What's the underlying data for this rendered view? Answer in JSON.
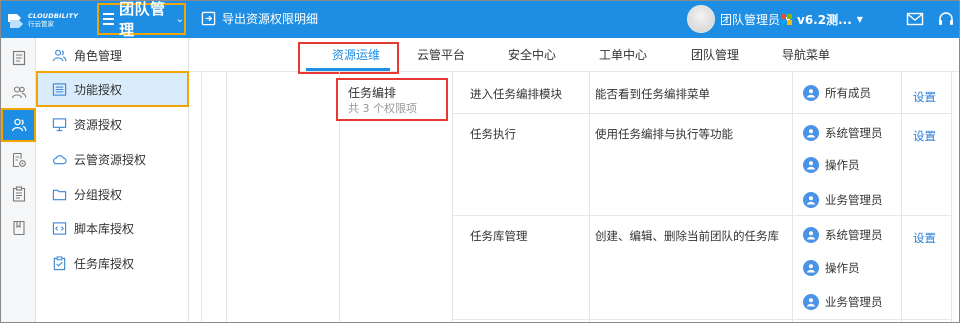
{
  "header": {
    "logo_en": "CLOUDBILITY",
    "logo_cn": "行云管家",
    "team_label": "团队管理",
    "export_label": "导出资源权限明细",
    "user_name": "团队管理员",
    "version": "v6.2测...",
    "colors": {
      "bar": "#1e8ee4",
      "highlight": "#f0a500"
    }
  },
  "rail": [
    "doc-icon",
    "people-icon",
    "user-group-icon",
    "settings-doc-icon",
    "clipboard-icon",
    "book-icon"
  ],
  "sidebar": {
    "items": [
      {
        "label": "角色管理",
        "icon": "role-icon"
      },
      {
        "label": "功能授权",
        "icon": "list-icon"
      },
      {
        "label": "资源授权",
        "icon": "monitor-icon"
      },
      {
        "label": "云管资源授权",
        "icon": "cloud-icon"
      },
      {
        "label": "分组授权",
        "icon": "folder-icon"
      },
      {
        "label": "脚本库授权",
        "icon": "script-icon"
      },
      {
        "label": "任务库授权",
        "icon": "task-icon"
      }
    ]
  },
  "tabs": [
    "资源运维",
    "云管平台",
    "安全中心",
    "工单中心",
    "团队管理",
    "导航菜单"
  ],
  "permissions": {
    "category": {
      "name": "任务编排",
      "count": "共 3 个权限项"
    },
    "rows": [
      {
        "name": "进入任务编排模块",
        "desc": "能否看到任务编排菜单",
        "roles": [
          "所有成员"
        ],
        "action": "设置"
      },
      {
        "name": "任务执行",
        "desc": "使用任务编排与执行等功能",
        "roles": [
          "系统管理员",
          "操作员",
          "业务管理员"
        ],
        "action": "设置"
      },
      {
        "name": "任务库管理",
        "desc": "创建、编辑、删除当前团队的任务库",
        "roles": [
          "系统管理员",
          "操作员",
          "业务管理员"
        ],
        "action": "设置"
      }
    ]
  }
}
